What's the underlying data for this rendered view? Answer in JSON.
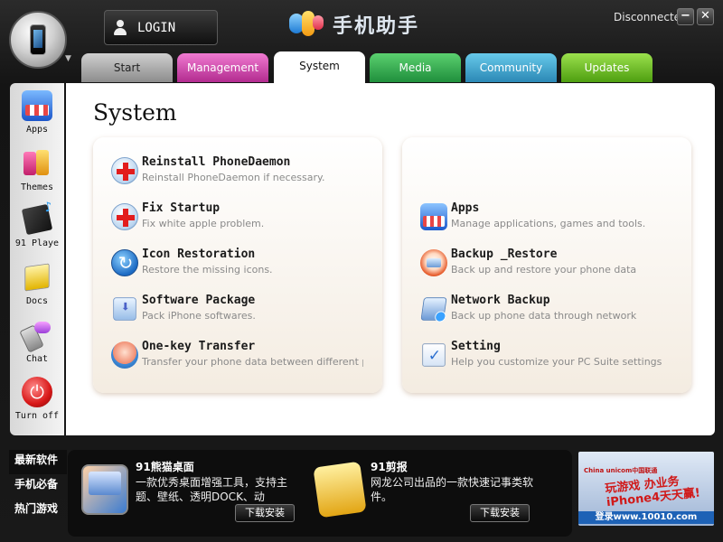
{
  "window": {
    "login_label": "LOGIN",
    "logo_text": "手机助手",
    "connection_status": "Disconnected",
    "minimize_label": "−",
    "close_label": "✕"
  },
  "tabs": [
    {
      "label": "Start"
    },
    {
      "label": "Management"
    },
    {
      "label": "System"
    },
    {
      "label": "Media"
    },
    {
      "label": "Community"
    },
    {
      "label": "Updates"
    }
  ],
  "sidebar": {
    "items": [
      {
        "label": "Apps",
        "icon": "apps-store-icon"
      },
      {
        "label": "Themes",
        "icon": "themes-icon"
      },
      {
        "label": "91 Playe",
        "icon": "player-icon"
      },
      {
        "label": "Docs",
        "icon": "docs-icon"
      },
      {
        "label": "Chat",
        "icon": "chat-icon"
      },
      {
        "label": "Turn off",
        "icon": "power-icon"
      }
    ]
  },
  "main": {
    "title": "System",
    "left_items": [
      {
        "title": "Reinstall PhoneDaemon",
        "desc": "Reinstall PhoneDaemon if necessary.",
        "icon": "medical-plus-icon"
      },
      {
        "title": "Fix Startup",
        "desc": "Fix white apple problem.",
        "icon": "medical-plus-icon"
      },
      {
        "title": "Icon Restoration",
        "desc": "Restore the missing icons.",
        "icon": "restore-icon"
      },
      {
        "title": "Software Package",
        "desc": "Pack iPhone softwares.",
        "icon": "package-icon"
      },
      {
        "title": "One-key Transfer",
        "desc": "Transfer your phone data between different p",
        "icon": "transfer-icon"
      }
    ],
    "right_items": [
      {
        "title": "Apps",
        "desc": "Manage applications, games and tools.",
        "icon": "apps-store-icon"
      },
      {
        "title": "Backup _Restore",
        "desc": "Back up and restore your phone data",
        "icon": "backup-icon"
      },
      {
        "title": "Network Backup",
        "desc": "Back up phone data through network",
        "icon": "network-backup-icon"
      },
      {
        "title": "Setting",
        "desc": "Help you customize your PC Suite settings",
        "icon": "settings-check-icon"
      }
    ]
  },
  "bottom": {
    "nav": [
      {
        "label": "最新软件"
      },
      {
        "label": "手机必备"
      },
      {
        "label": "热门游戏"
      }
    ],
    "promos": [
      {
        "title": "91熊猫桌面",
        "desc": "一款优秀桌面增强工具，支持主题、壁纸、透明DOCK、动",
        "install_label": "下载安装",
        "icon": "desktop-app-icon"
      },
      {
        "title": "91剪报",
        "desc": "网龙公司出品的一款快速记事类软件。",
        "install_label": "下载安装",
        "icon": "notes-app-icon"
      }
    ],
    "ad": {
      "brand": "China unicom中国联通",
      "text": "玩游戏 办业务 iPhone4天天赢!",
      "url": "登录www.10010.com"
    }
  }
}
